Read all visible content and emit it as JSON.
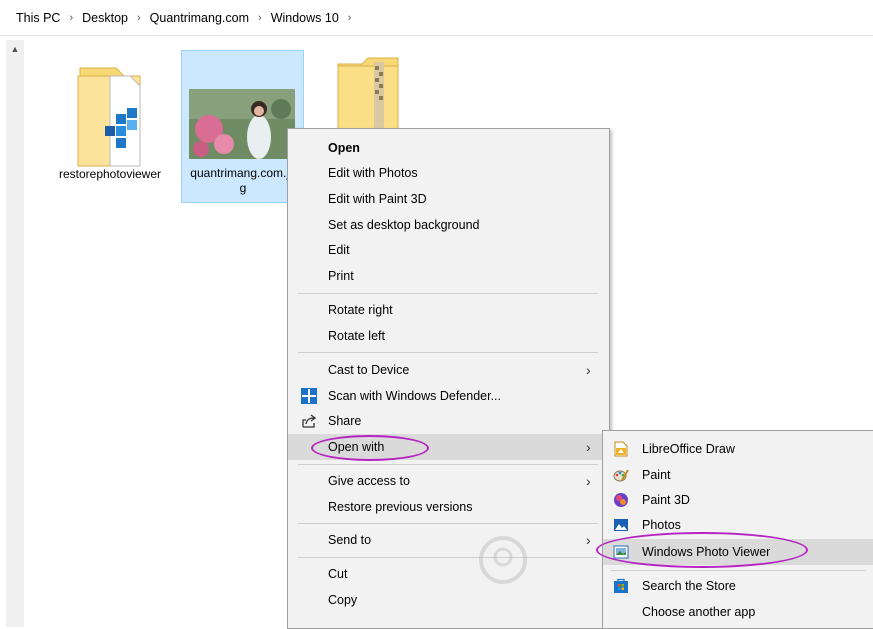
{
  "breadcrumb": {
    "items": [
      "This PC",
      "Desktop",
      "Quantrimang.com",
      "Windows 10"
    ],
    "separator": "›"
  },
  "files": [
    {
      "label": "restorephotoviewer",
      "icon": "registry-file-icon"
    },
    {
      "label": "quantrimang.com.jpg",
      "icon": "image-thumbnail",
      "selected": true
    },
    {
      "label": "",
      "icon": "zip-folder-icon"
    }
  ],
  "context_menu": {
    "items": [
      {
        "label": "Open",
        "bold": true
      },
      {
        "label": "Edit with Photos"
      },
      {
        "label": "Edit with Paint 3D"
      },
      {
        "label": "Set as desktop background"
      },
      {
        "label": "Edit"
      },
      {
        "label": "Print"
      },
      {
        "label": "Rotate right"
      },
      {
        "label": "Rotate left"
      },
      {
        "label": "Cast to Device",
        "submenu": true
      },
      {
        "label": "Scan with Windows Defender...",
        "icon": "windows-defender-icon"
      },
      {
        "label": "Share",
        "icon": "share-icon"
      },
      {
        "label": "Open with",
        "submenu": true,
        "highlighted": true
      },
      {
        "label": "Give access to",
        "submenu": true
      },
      {
        "label": "Restore previous versions"
      },
      {
        "label": "Send to",
        "submenu": true
      },
      {
        "label": "Cut"
      },
      {
        "label": "Copy"
      }
    ]
  },
  "open_with_menu": {
    "items": [
      {
        "label": "LibreOffice Draw",
        "icon": "libreoffice-draw-icon"
      },
      {
        "label": "Paint",
        "icon": "paint-icon"
      },
      {
        "label": "Paint 3D",
        "icon": "paint-3d-icon"
      },
      {
        "label": "Photos",
        "icon": "photos-icon"
      },
      {
        "label": "Windows Photo Viewer",
        "icon": "photo-viewer-icon",
        "highlighted": true
      },
      {
        "label": "Search the Store",
        "icon": "store-icon"
      },
      {
        "label": "Choose another app"
      }
    ]
  },
  "colors": {
    "highlight_ellipse": "#b623c3",
    "selection": "#cce8ff"
  }
}
